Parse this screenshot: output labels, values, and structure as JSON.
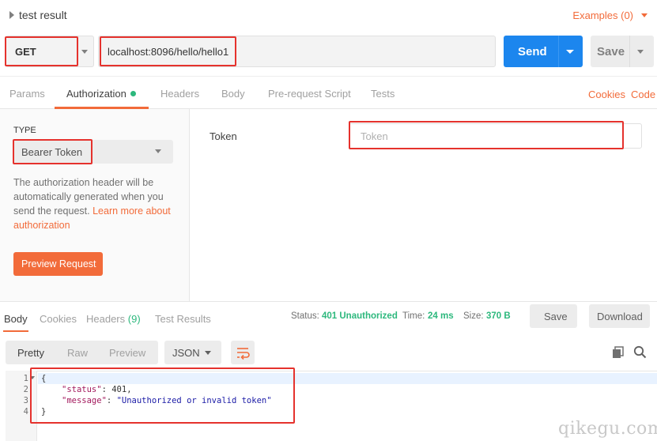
{
  "request": {
    "name": "test result",
    "examples_label": "Examples (0)",
    "method": "GET",
    "url": "localhost:8096/hello/hello1",
    "send_label": "Send",
    "save_label": "Save"
  },
  "request_tabs": [
    {
      "label": "Params"
    },
    {
      "label": "Authorization",
      "active": true,
      "has_indicator": true
    },
    {
      "label": "Headers"
    },
    {
      "label": "Body"
    },
    {
      "label": "Pre-request Script"
    },
    {
      "label": "Tests"
    }
  ],
  "links": {
    "cookies": "Cookies",
    "code": "Code"
  },
  "auth": {
    "type_label": "TYPE",
    "type_value": "Bearer Token",
    "description": "The authorization header will be automatically generated when you send the request.",
    "learn_more": "Learn more about authorization",
    "preview_label": "Preview Request",
    "token_label": "Token",
    "token_placeholder": "Token",
    "token_value": ""
  },
  "response_tabs": [
    {
      "label": "Body",
      "active": true
    },
    {
      "label": "Cookies"
    },
    {
      "label": "Headers",
      "count": "(9)"
    },
    {
      "label": "Test Results"
    }
  ],
  "response_status": {
    "status_label": "Status:",
    "status_value": "401 Unauthorized",
    "time_label": "Time:",
    "time_value": "24 ms",
    "size_label": "Size:",
    "size_value": "370 B",
    "save_label": "Save",
    "download_label": "Download"
  },
  "format": {
    "modes": [
      "Pretty",
      "Raw",
      "Preview"
    ],
    "active_mode": "Pretty",
    "language": "JSON"
  },
  "response_body": {
    "line_numbers": [
      "1",
      "2",
      "3",
      "4"
    ],
    "open_brace": "{",
    "status_key": "\"status\"",
    "status_value": "401",
    "message_key": "\"message\"",
    "message_value": "\"Unauthorized or invalid token\"",
    "close_brace": "}"
  },
  "colors": {
    "accent": "#f26b3a",
    "send_blue": "#1c86ee",
    "success_green": "#2db87d",
    "highlight_red": "#e5322d"
  },
  "watermark": "qikegu.com"
}
